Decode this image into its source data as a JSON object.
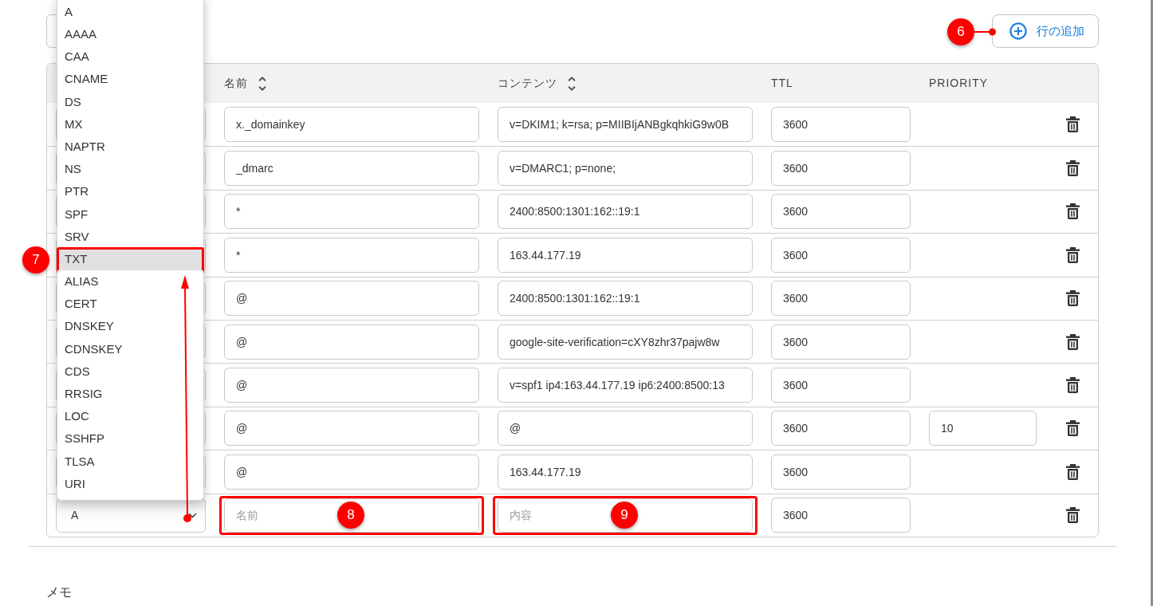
{
  "toolbar": {
    "add_row_button": {
      "label": "行の追加",
      "callout": "6"
    }
  },
  "table": {
    "columns": [
      {
        "label": "名前",
        "sortable": true
      },
      {
        "label": "コンテンツ",
        "sortable": true
      },
      {
        "label": "TTL",
        "sortable": false
      },
      {
        "label": "PRIORITY",
        "sortable": false
      }
    ],
    "rows": [
      {
        "name": "x._domainkey",
        "content": "v=DKIM1; k=rsa; p=MIIBIjANBgkqhkiG9w0B",
        "ttl": "3600"
      },
      {
        "name": "_dmarc",
        "content": "v=DMARC1; p=none;",
        "ttl": "3600"
      },
      {
        "name": "*",
        "content": "2400:8500:1301:162::19:1",
        "ttl": "3600"
      },
      {
        "name": "*",
        "content": "163.44.177.19",
        "ttl": "3600"
      },
      {
        "name": "@",
        "content": "2400:8500:1301:162::19:1",
        "ttl": "3600"
      },
      {
        "name": "@",
        "content": "google-site-verification=cXY8zhr37pajw8w",
        "ttl": "3600"
      },
      {
        "name": "@",
        "content": "v=spf1 ip4:163.44.177.19 ip6:2400:8500:13",
        "ttl": "3600"
      },
      {
        "name": "@",
        "content": "@",
        "ttl": "3600",
        "priority": "10"
      },
      {
        "name": "@",
        "content": "163.44.177.19",
        "ttl": "3600"
      }
    ],
    "new_row": {
      "type": "A",
      "name_placeholder": "名前",
      "name_callout": "8",
      "content_placeholder": "内容",
      "content_callout": "9",
      "ttl": "3600"
    }
  },
  "type_menu": {
    "callout": "7",
    "options": [
      {
        "label": "A",
        "selected": false
      },
      {
        "label": "AAAA",
        "selected": false
      },
      {
        "label": "CAA",
        "selected": false
      },
      {
        "label": "CNAME",
        "selected": false
      },
      {
        "label": "DS",
        "selected": false
      },
      {
        "label": "MX",
        "selected": false
      },
      {
        "label": "NAPTR",
        "selected": false
      },
      {
        "label": "NS",
        "selected": false
      },
      {
        "label": "PTR",
        "selected": false
      },
      {
        "label": "SPF",
        "selected": false
      },
      {
        "label": "SRV",
        "selected": false
      },
      {
        "label": "TXT",
        "selected": true
      },
      {
        "label": "ALIAS",
        "selected": false
      },
      {
        "label": "CERT",
        "selected": false
      },
      {
        "label": "DNSKEY",
        "selected": false
      },
      {
        "label": "CDNSKEY",
        "selected": false
      },
      {
        "label": "CDS",
        "selected": false
      },
      {
        "label": "RRSIG",
        "selected": false
      },
      {
        "label": "LOC",
        "selected": false
      },
      {
        "label": "SSHFP",
        "selected": false
      },
      {
        "label": "TLSA",
        "selected": false
      },
      {
        "label": "URI",
        "selected": false
      }
    ]
  },
  "memo": {
    "label": "メモ"
  }
}
